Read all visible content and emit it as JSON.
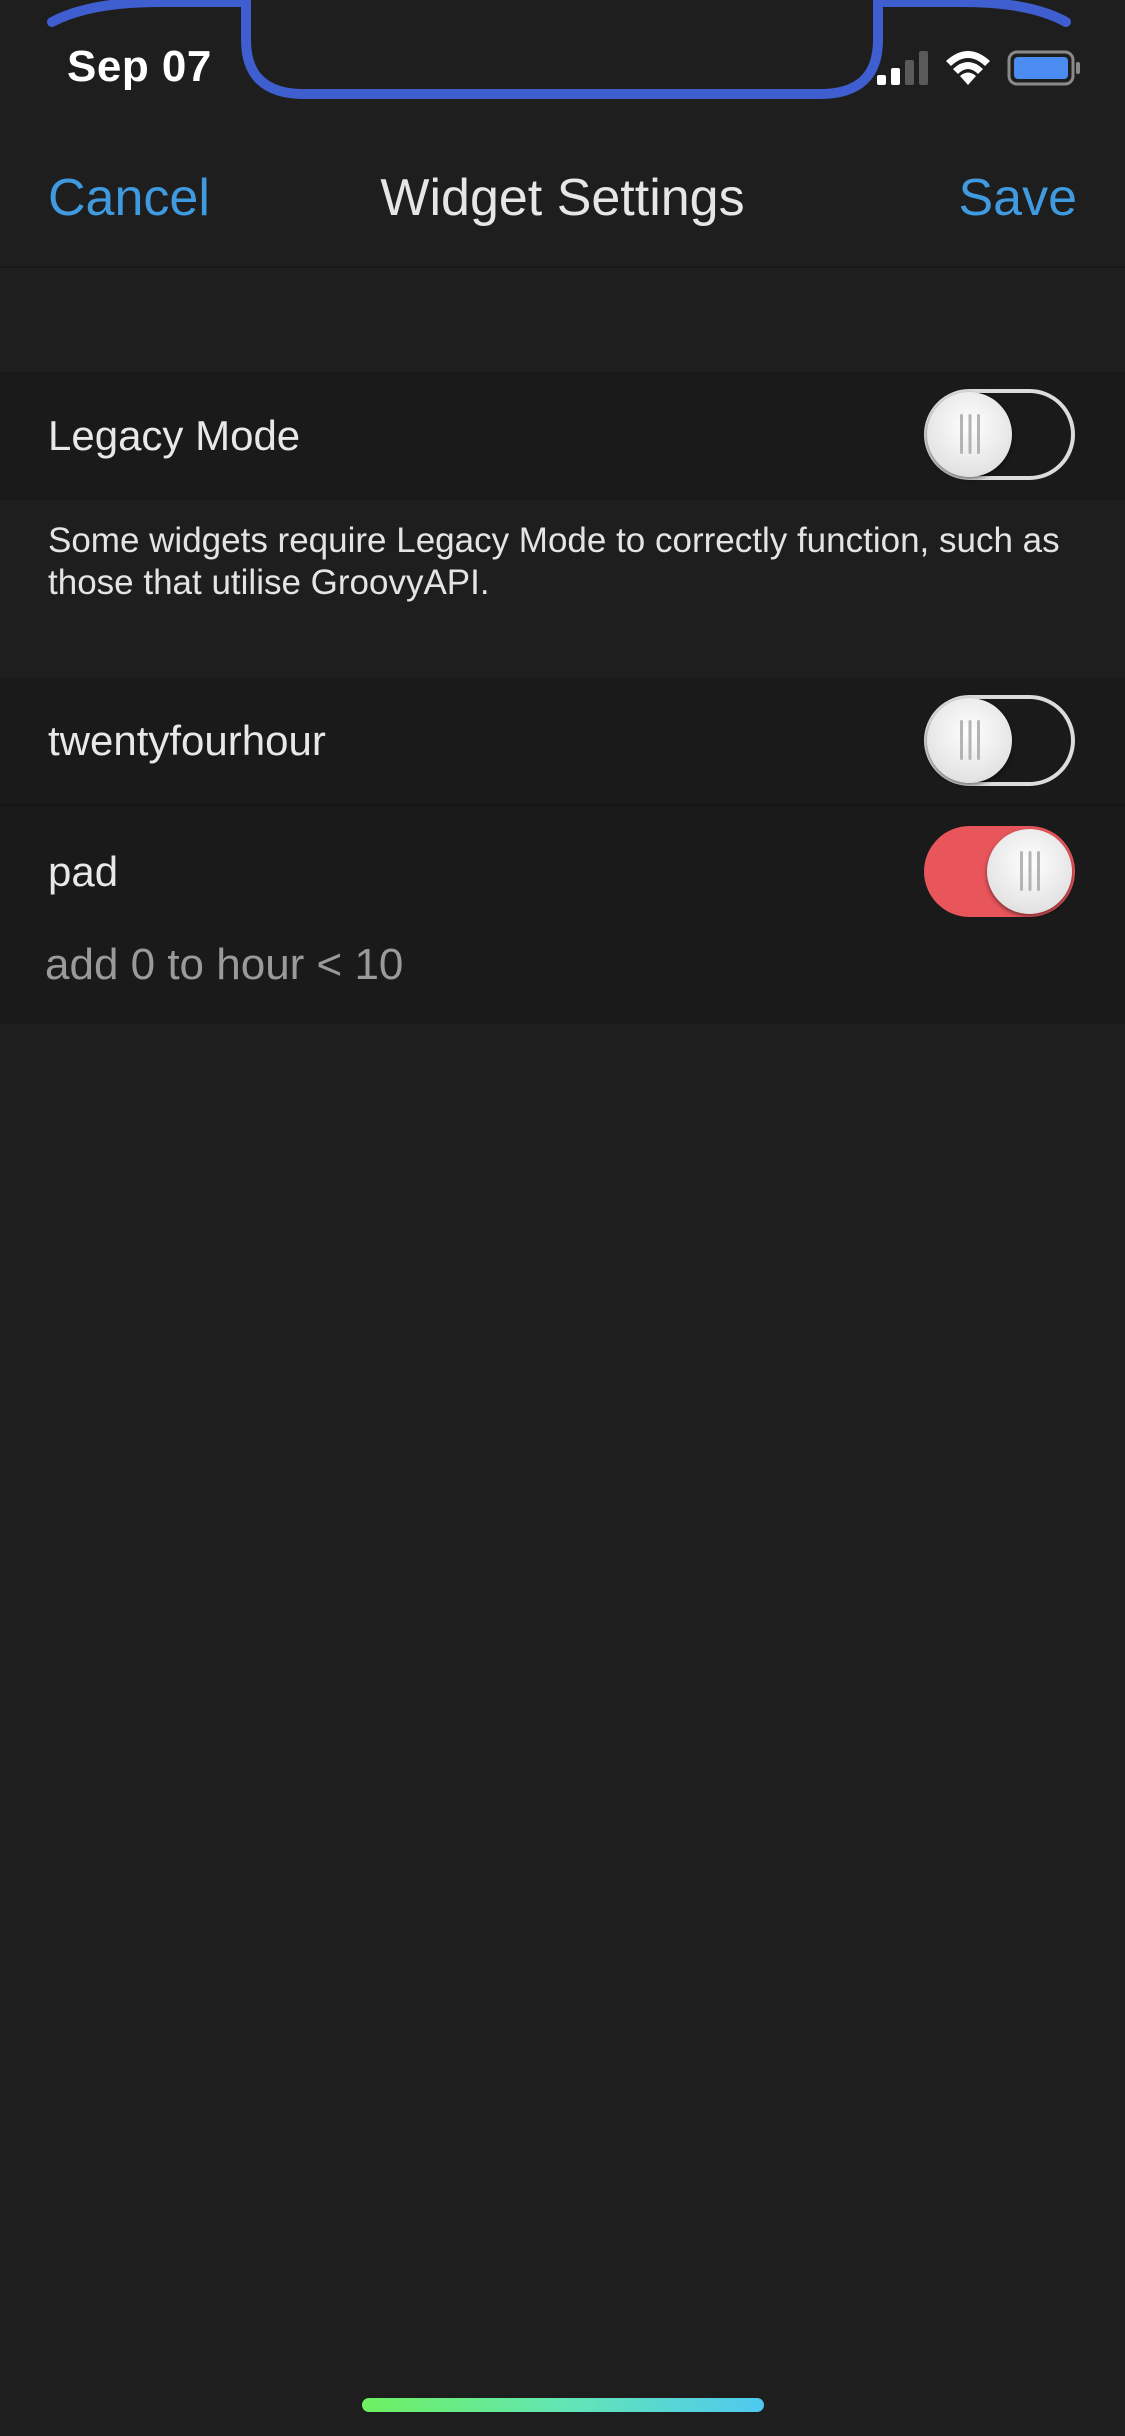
{
  "status_bar": {
    "time": "Sep 07"
  },
  "nav": {
    "cancel_label": "Cancel",
    "title": "Widget Settings",
    "save_label": "Save"
  },
  "settings": {
    "legacy_mode": {
      "label": "Legacy Mode",
      "enabled": false,
      "footer": "Some widgets require Legacy Mode to correctly function, such as those that utilise GroovyAPI."
    },
    "twentyfourhour": {
      "label": "twentyfourhour",
      "enabled": false
    },
    "pad": {
      "label": "pad",
      "enabled": true,
      "description": "add 0 to hour < 10"
    }
  },
  "colors": {
    "accent": "#3f9ae0",
    "toggle_on": "#e8565c",
    "frame_outline": "#3f5ed0",
    "background": "#1e1e1e"
  },
  "icons": {
    "signal": "cellular-signal-icon",
    "wifi": "wifi-icon",
    "battery": "battery-icon"
  }
}
